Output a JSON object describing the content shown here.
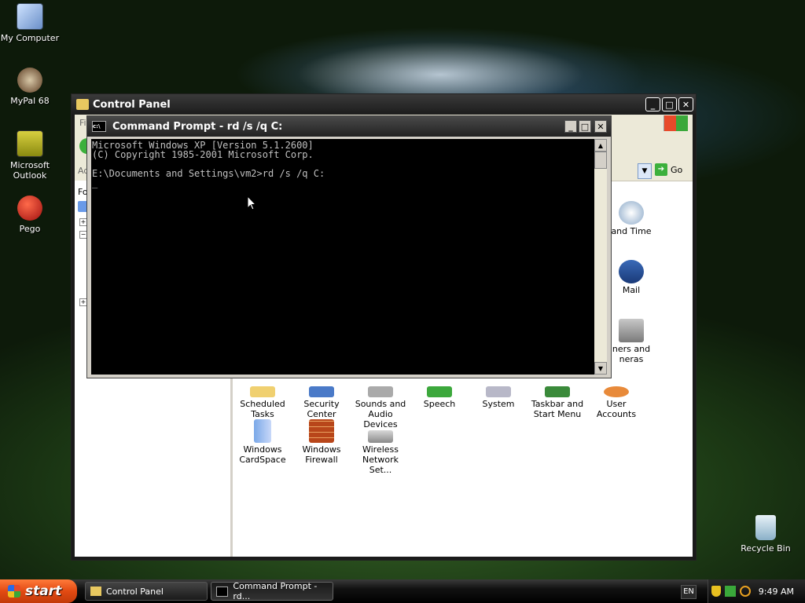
{
  "desktop": {
    "icons": [
      {
        "label": "My Computer"
      },
      {
        "label": "MyPal 68"
      },
      {
        "label": "Microsoft Outlook"
      },
      {
        "label": "Pego"
      },
      {
        "label": "Recycle Bin"
      }
    ]
  },
  "control_panel": {
    "title": "Control Panel",
    "menu_partial": "Fi",
    "address_partial": "Ad",
    "go_label": "Go",
    "sidebar_partial": "Fo",
    "items_partial": [
      "and Time",
      "Mail",
      "ners and\nneras"
    ],
    "items": [
      {
        "label": "Scheduled\nTasks"
      },
      {
        "label": "Security\nCenter"
      },
      {
        "label": "Sounds and\nAudio Devices"
      },
      {
        "label": "Speech"
      },
      {
        "label": "System"
      },
      {
        "label": "Taskbar and\nStart Menu"
      },
      {
        "label": "User Accounts"
      },
      {
        "label": "Windows\nCardSpace"
      },
      {
        "label": "Windows\nFirewall"
      },
      {
        "label": "Wireless\nNetwork Set..."
      }
    ]
  },
  "cmd": {
    "title": "Command Prompt - rd /s /q C:",
    "output": "Microsoft Windows XP [Version 5.1.2600]\n(C) Copyright 1985-2001 Microsoft Corp.\n\nE:\\Documents and Settings\\vm2>rd /s /q C:\n_"
  },
  "taskbar": {
    "start_label": "start",
    "tasks": [
      {
        "label": "Control Panel"
      },
      {
        "label": "Command Prompt - rd..."
      }
    ],
    "lang": "EN",
    "clock": "9:49 AM"
  }
}
